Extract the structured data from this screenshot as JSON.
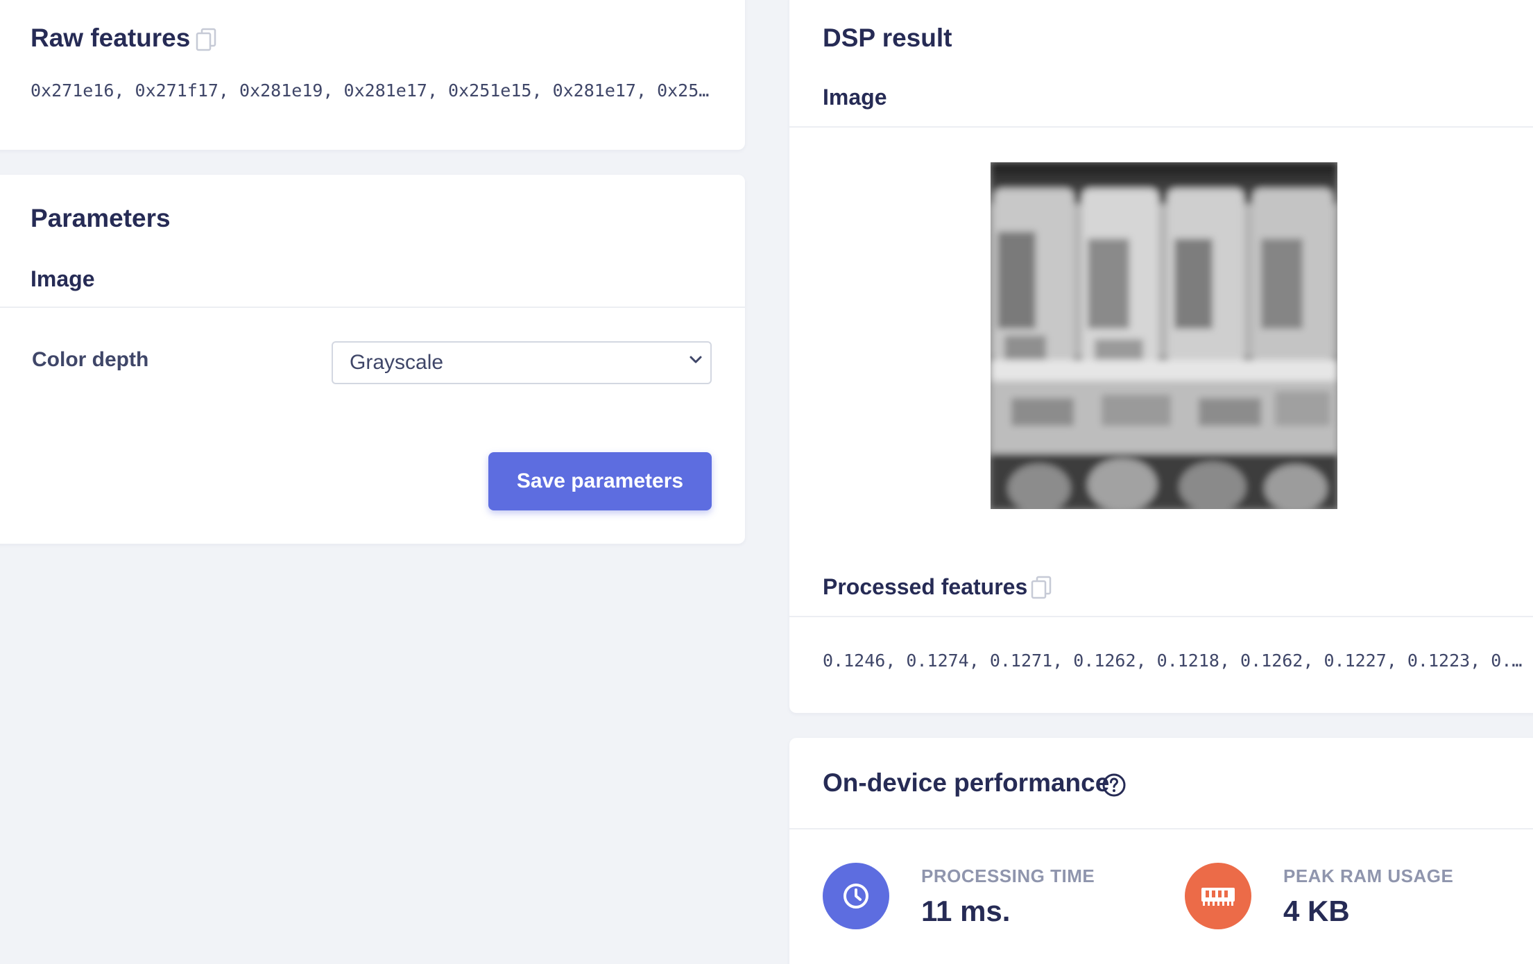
{
  "raw_features": {
    "title": "Raw features",
    "copy_icon": "copy-icon",
    "values": "0x271e16, 0x271f17, 0x281e19, 0x281e17, 0x251e15, 0x281e17, 0x251e…"
  },
  "parameters": {
    "title": "Parameters",
    "section": "Image",
    "color_depth_label": "Color depth",
    "color_depth_value": "Grayscale",
    "save_label": "Save parameters"
  },
  "dsp_result": {
    "title": "DSP result",
    "section": "Image",
    "processed_title": "Processed features",
    "copy_icon": "copy-icon",
    "processed_values": "0.1246, 0.1274, 0.1271, 0.1262, 0.1218, 0.1262, 0.1227, 0.1223, 0.…"
  },
  "performance": {
    "title": "On-device performance",
    "help_icon": "question-circle-icon",
    "processing_time_label": "PROCESSING TIME",
    "processing_time_value": "11 ms.",
    "processing_icon": "clock-icon",
    "peak_ram_label": "PEAK RAM USAGE",
    "peak_ram_value": "4 KB",
    "ram_icon": "memory-chip-icon"
  },
  "colors": {
    "accent": "#5d6de0",
    "ram_accent": "#ec6b48",
    "background": "#f1f3f7",
    "text": "#262b55"
  }
}
